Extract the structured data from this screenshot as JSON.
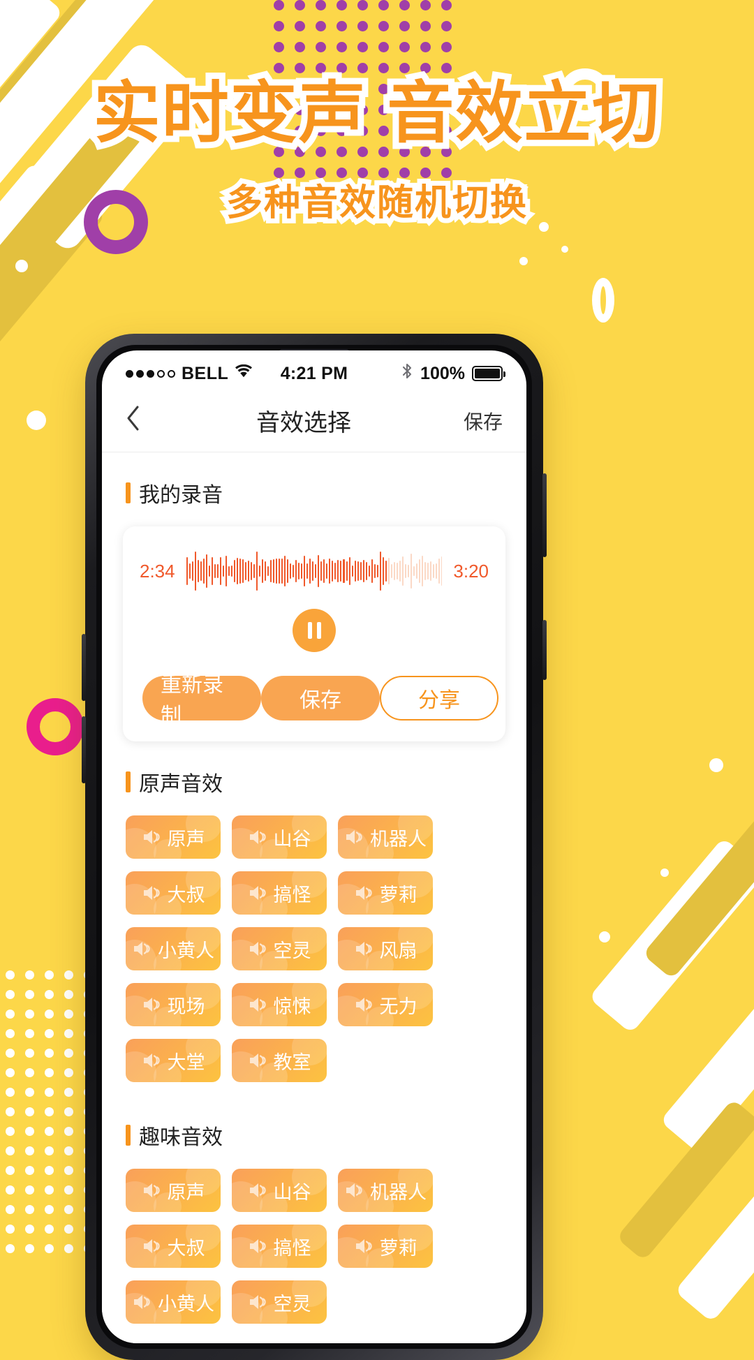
{
  "poster": {
    "headline": "实时变声 音效立切",
    "subheadline": "多种音效随机切换",
    "bg_color": "#FCD749",
    "accent_orange": "#F7941D",
    "accent_purple": "#A03FA8",
    "accent_magenta": "#E91E8C"
  },
  "phone": {
    "statusbar": {
      "carrier": "BELL",
      "wifi_icon": "wifi-icon",
      "time": "4:21 PM",
      "bluetooth_icon": "bluetooth-icon",
      "battery_percent": "100%",
      "signal_dots_filled": 3,
      "signal_dots_total": 5
    },
    "navbar": {
      "back_icon": "chevron-left-icon",
      "title": "音效选择",
      "save_label": "保存"
    },
    "recording": {
      "section_label": "我的录音",
      "current_time": "2:34",
      "total_time": "3:20",
      "play_state_icon": "pause-icon",
      "actions": [
        {
          "label": "重新录制",
          "style": "solid",
          "name": "re-record-button"
        },
        {
          "label": "保存",
          "style": "solid",
          "name": "save-recording-button"
        },
        {
          "label": "分享",
          "style": "outline",
          "name": "share-button"
        }
      ]
    },
    "sections": [
      {
        "title": "原声音效",
        "name": "original-effects",
        "chips": [
          "原声",
          "山谷",
          "机器人",
          "大叔",
          "搞怪",
          "萝莉",
          "小黄人",
          "空灵",
          "风扇",
          "现场",
          "惊悚",
          "无力",
          "大堂",
          "教室"
        ]
      },
      {
        "title": "趣味音效",
        "name": "fun-effects",
        "chips": [
          "原声",
          "山谷",
          "机器人",
          "大叔",
          "搞怪",
          "萝莉",
          "小黄人",
          "空灵"
        ]
      }
    ],
    "chip_icon": "speaker-icon"
  }
}
